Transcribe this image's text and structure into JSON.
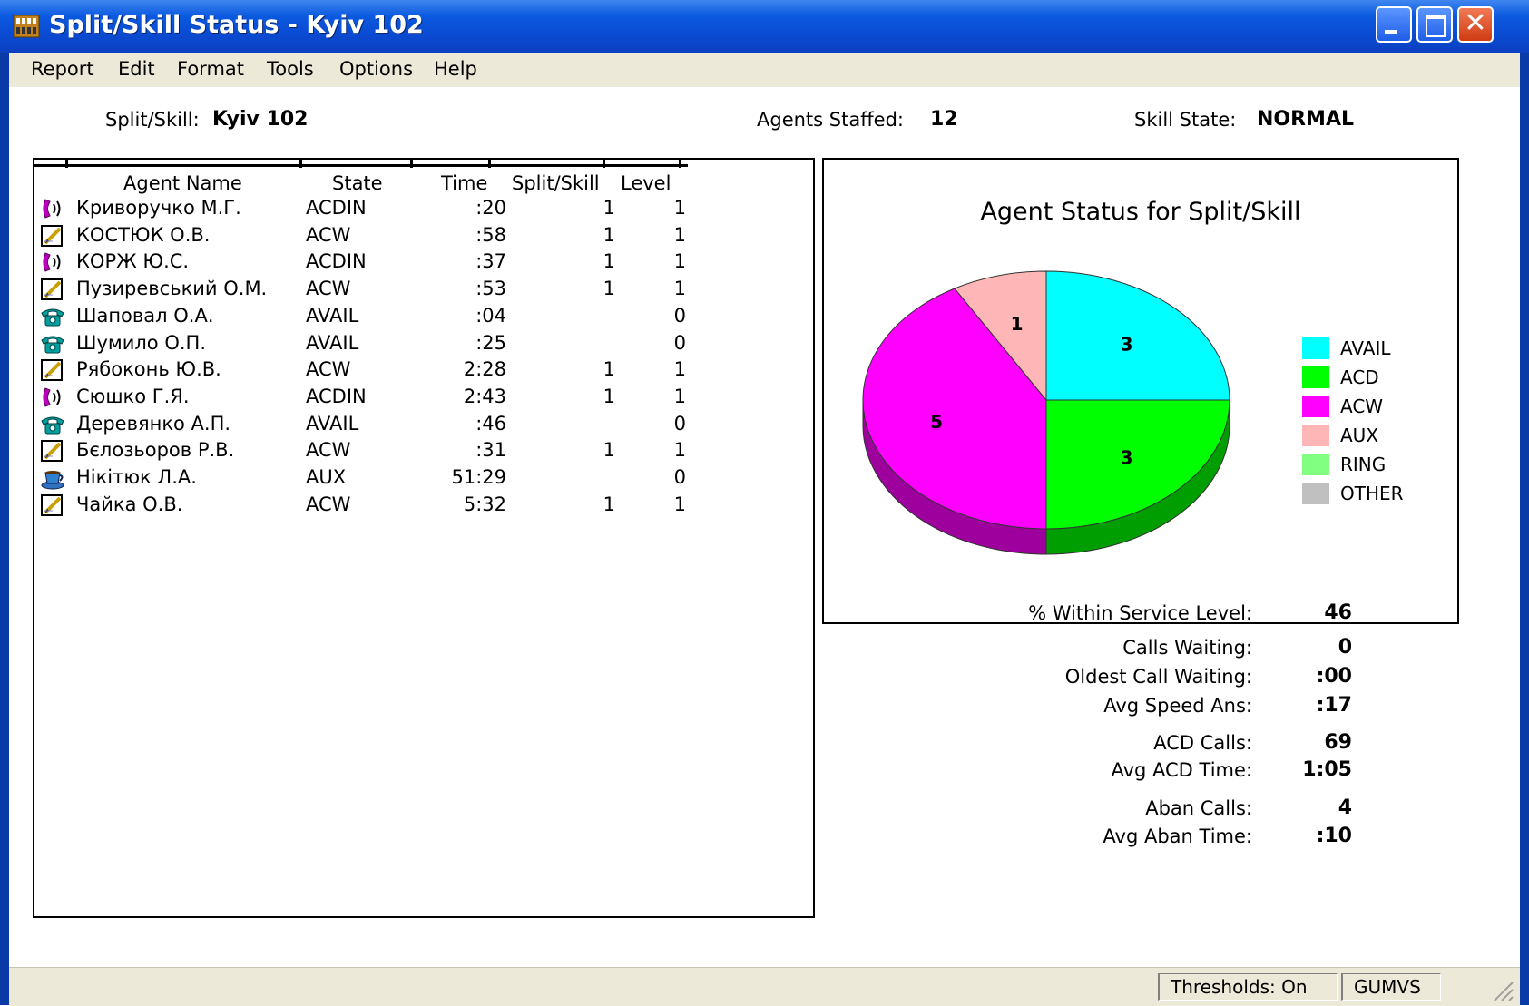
{
  "window": {
    "title": "Split/Skill Status - Kyiv 102"
  },
  "menu": [
    "Report",
    "Edit",
    "Format",
    "Tools",
    "Options",
    "Help"
  ],
  "header": {
    "split_label": "Split/Skill:",
    "split_value": "Kyiv 102",
    "staffed_label": "Agents Staffed:",
    "staffed_value": "12",
    "state_label": "Skill State:",
    "state_value": "NORMAL"
  },
  "table": {
    "columns": [
      "Agent Name",
      "State",
      "Time",
      "Split/Skill",
      "Level"
    ],
    "rows": [
      {
        "icon": "acd-call-icon",
        "name": "Криворучко М.Г.",
        "state": "ACDIN",
        "time": ":20",
        "split": "1",
        "level": "1"
      },
      {
        "icon": "acw-notepad-icon",
        "name": "КОСТЮК О.В.",
        "state": "ACW",
        "time": ":58",
        "split": "1",
        "level": "1"
      },
      {
        "icon": "acd-call-icon",
        "name": "КОРЖ Ю.С.",
        "state": "ACDIN",
        "time": ":37",
        "split": "1",
        "level": "1"
      },
      {
        "icon": "acw-notepad-icon",
        "name": "Пузиревський О.М.",
        "state": "ACW",
        "time": ":53",
        "split": "1",
        "level": "1"
      },
      {
        "icon": "avail-phone-icon",
        "name": "Шаповал О.А.",
        "state": "AVAIL",
        "time": ":04",
        "split": "",
        "level": "0"
      },
      {
        "icon": "avail-phone-icon",
        "name": "Шумило О.П.",
        "state": "AVAIL",
        "time": ":25",
        "split": "",
        "level": "0"
      },
      {
        "icon": "acw-notepad-icon",
        "name": "Рябоконь Ю.В.",
        "state": "ACW",
        "time": "2:28",
        "split": "1",
        "level": "1"
      },
      {
        "icon": "acd-call-icon",
        "name": "Сюшко Г.Я.",
        "state": "ACDIN",
        "time": "2:43",
        "split": "1",
        "level": "1"
      },
      {
        "icon": "avail-phone-icon",
        "name": "Деревянко А.П.",
        "state": "AVAIL",
        "time": ":46",
        "split": "",
        "level": "0"
      },
      {
        "icon": "acw-notepad-icon",
        "name": "Бєлозьоров Р.В.",
        "state": "ACW",
        "time": ":31",
        "split": "1",
        "level": "1"
      },
      {
        "icon": "aux-coffee-icon",
        "name": "Нікітюк Л.А.",
        "state": "AUX",
        "time": "51:29",
        "split": "",
        "level": "0"
      },
      {
        "icon": "acw-notepad-icon",
        "name": "Чайка О.В.",
        "state": "ACW",
        "time": "5:32",
        "split": "1",
        "level": "1"
      }
    ]
  },
  "chart_data": {
    "type": "pie",
    "title": "Agent Status for Split/Skill",
    "slices": [
      {
        "label": "AVAIL",
        "value": 3,
        "color": "#00ffff"
      },
      {
        "label": "ACD",
        "value": 3,
        "color": "#00ff00"
      },
      {
        "label": "ACW",
        "value": 5,
        "color": "#ff00ff"
      },
      {
        "label": "AUX",
        "value": 1,
        "color": "#ffb6b6"
      }
    ],
    "legend": [
      {
        "label": "AVAIL",
        "color": "#00ffff"
      },
      {
        "label": "ACD",
        "color": "#00ff00"
      },
      {
        "label": "ACW",
        "color": "#ff00ff"
      },
      {
        "label": "AUX",
        "color": "#ffb6b6"
      },
      {
        "label": "RING",
        "color": "#80ff80"
      },
      {
        "label": "OTHER",
        "color": "#c0c0c0"
      }
    ],
    "legend_position": "right"
  },
  "stats": [
    {
      "label": "% Within Service Level:",
      "value": "46"
    },
    {
      "label": "Calls Waiting:",
      "value": "0"
    },
    {
      "label": "Oldest Call Waiting:",
      "value": ":00"
    },
    {
      "label": "Avg Speed Ans:",
      "value": ":17"
    },
    {
      "label": "ACD Calls:",
      "value": "69"
    },
    {
      "label": "Avg ACD Time:",
      "value": "1:05"
    },
    {
      "label": "Aban Calls:",
      "value": "4"
    },
    {
      "label": "Avg Aban Time:",
      "value": ":10"
    }
  ],
  "status_bar": {
    "thresholds": "Thresholds: On",
    "server": "GUMVS"
  }
}
